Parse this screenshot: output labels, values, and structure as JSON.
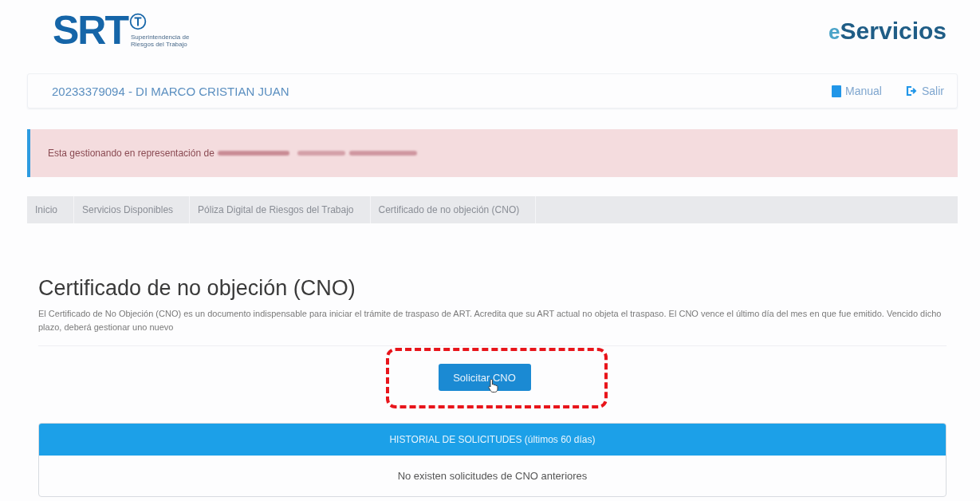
{
  "header": {
    "logo": "SRT",
    "logo_subtitle": [
      "Superintendencia de",
      "Riesgos del Trabajo"
    ],
    "brand_prefix": "e",
    "brand": "Servicios"
  },
  "user_bar": {
    "user": "20233379094 - DI MARCO CRISTIAN JUAN",
    "links": [
      {
        "label": "Manual",
        "kind": "book"
      },
      {
        "label": "Salir",
        "kind": "exit"
      }
    ]
  },
  "alert": {
    "text": "Esta gestionando en representación de"
  },
  "breadcrumb": [
    {
      "label": "Inicio"
    },
    {
      "label": "Servicios Disponibles"
    },
    {
      "label": "Póliza Digital de Riesgos del Trabajo"
    },
    {
      "label": "Certificado de no objeción (CNO)"
    }
  ],
  "page": {
    "title": "Certificado de no objeción (CNO)",
    "description": "El Certificado de No Objeción (CNO) es un documento indispensable para iniciar el trámite de traspaso de ART. Acredita que su ART actual no objeta el traspaso. El CNO vence el último día del mes en que fue emitido. Vencido dicho plazo, deberá gestionar uno nuevo",
    "button": "Solicitar CNO"
  },
  "history": {
    "title": "HISTORIAL DE SOLICITUDES (últimos 60 días)",
    "empty": "No existen solicitudes de CNO anteriores"
  }
}
